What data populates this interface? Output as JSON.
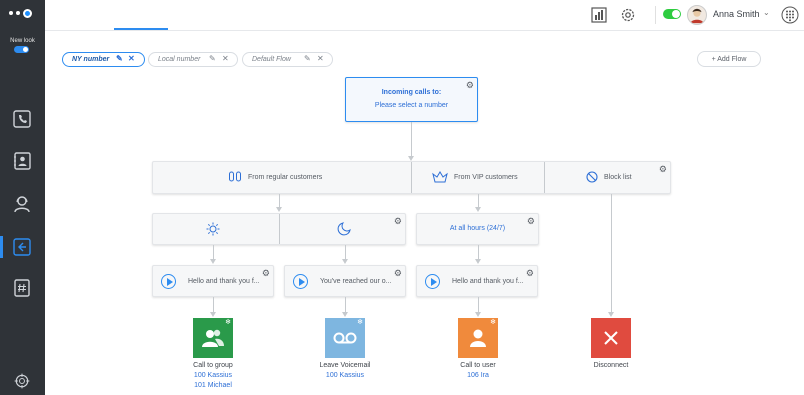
{
  "sidebar": {
    "new_look_label": "New look",
    "icons": [
      "calls-icon",
      "contacts-icon",
      "support-agent-icon",
      "call-flow-icon",
      "numbers-icon"
    ],
    "footer_icon": "settings-wheel-icon"
  },
  "header": {
    "user_name": "Anna Smith",
    "status_toggle_on": true
  },
  "flow_tabs": [
    {
      "label": "NY number",
      "active": true
    },
    {
      "label": "Local number",
      "active": false
    },
    {
      "label": "Default Flow",
      "active": false
    }
  ],
  "add_flow_label": "+ Add Flow",
  "flow": {
    "incoming": {
      "title": "Incoming calls to:",
      "subtitle": "Please select a number"
    },
    "branches": {
      "regular": "From regular customers",
      "vip": "From VIP customers",
      "block": "Block list"
    },
    "time_rule": "At all hours (24/7)",
    "greetings": [
      "Hello and thank you f...",
      "You've reached our o...",
      "Hello and thank you f..."
    ],
    "endpoints": [
      {
        "title": "Call to group",
        "lines": [
          "100 Kassius",
          "101 Michael"
        ],
        "color": "#2a9a4a"
      },
      {
        "title": "Leave Voicemail",
        "lines": [
          "100 Kassius"
        ],
        "color": "#7eb6e0"
      },
      {
        "title": "Call to user",
        "lines": [
          "106 Ira"
        ],
        "color": "#f08a3c"
      },
      {
        "title": "Disconnect",
        "lines": [],
        "color": "#e04b3f"
      }
    ]
  },
  "colors": {
    "accent": "#2d8cf0",
    "sidebar": "#2f3338"
  }
}
